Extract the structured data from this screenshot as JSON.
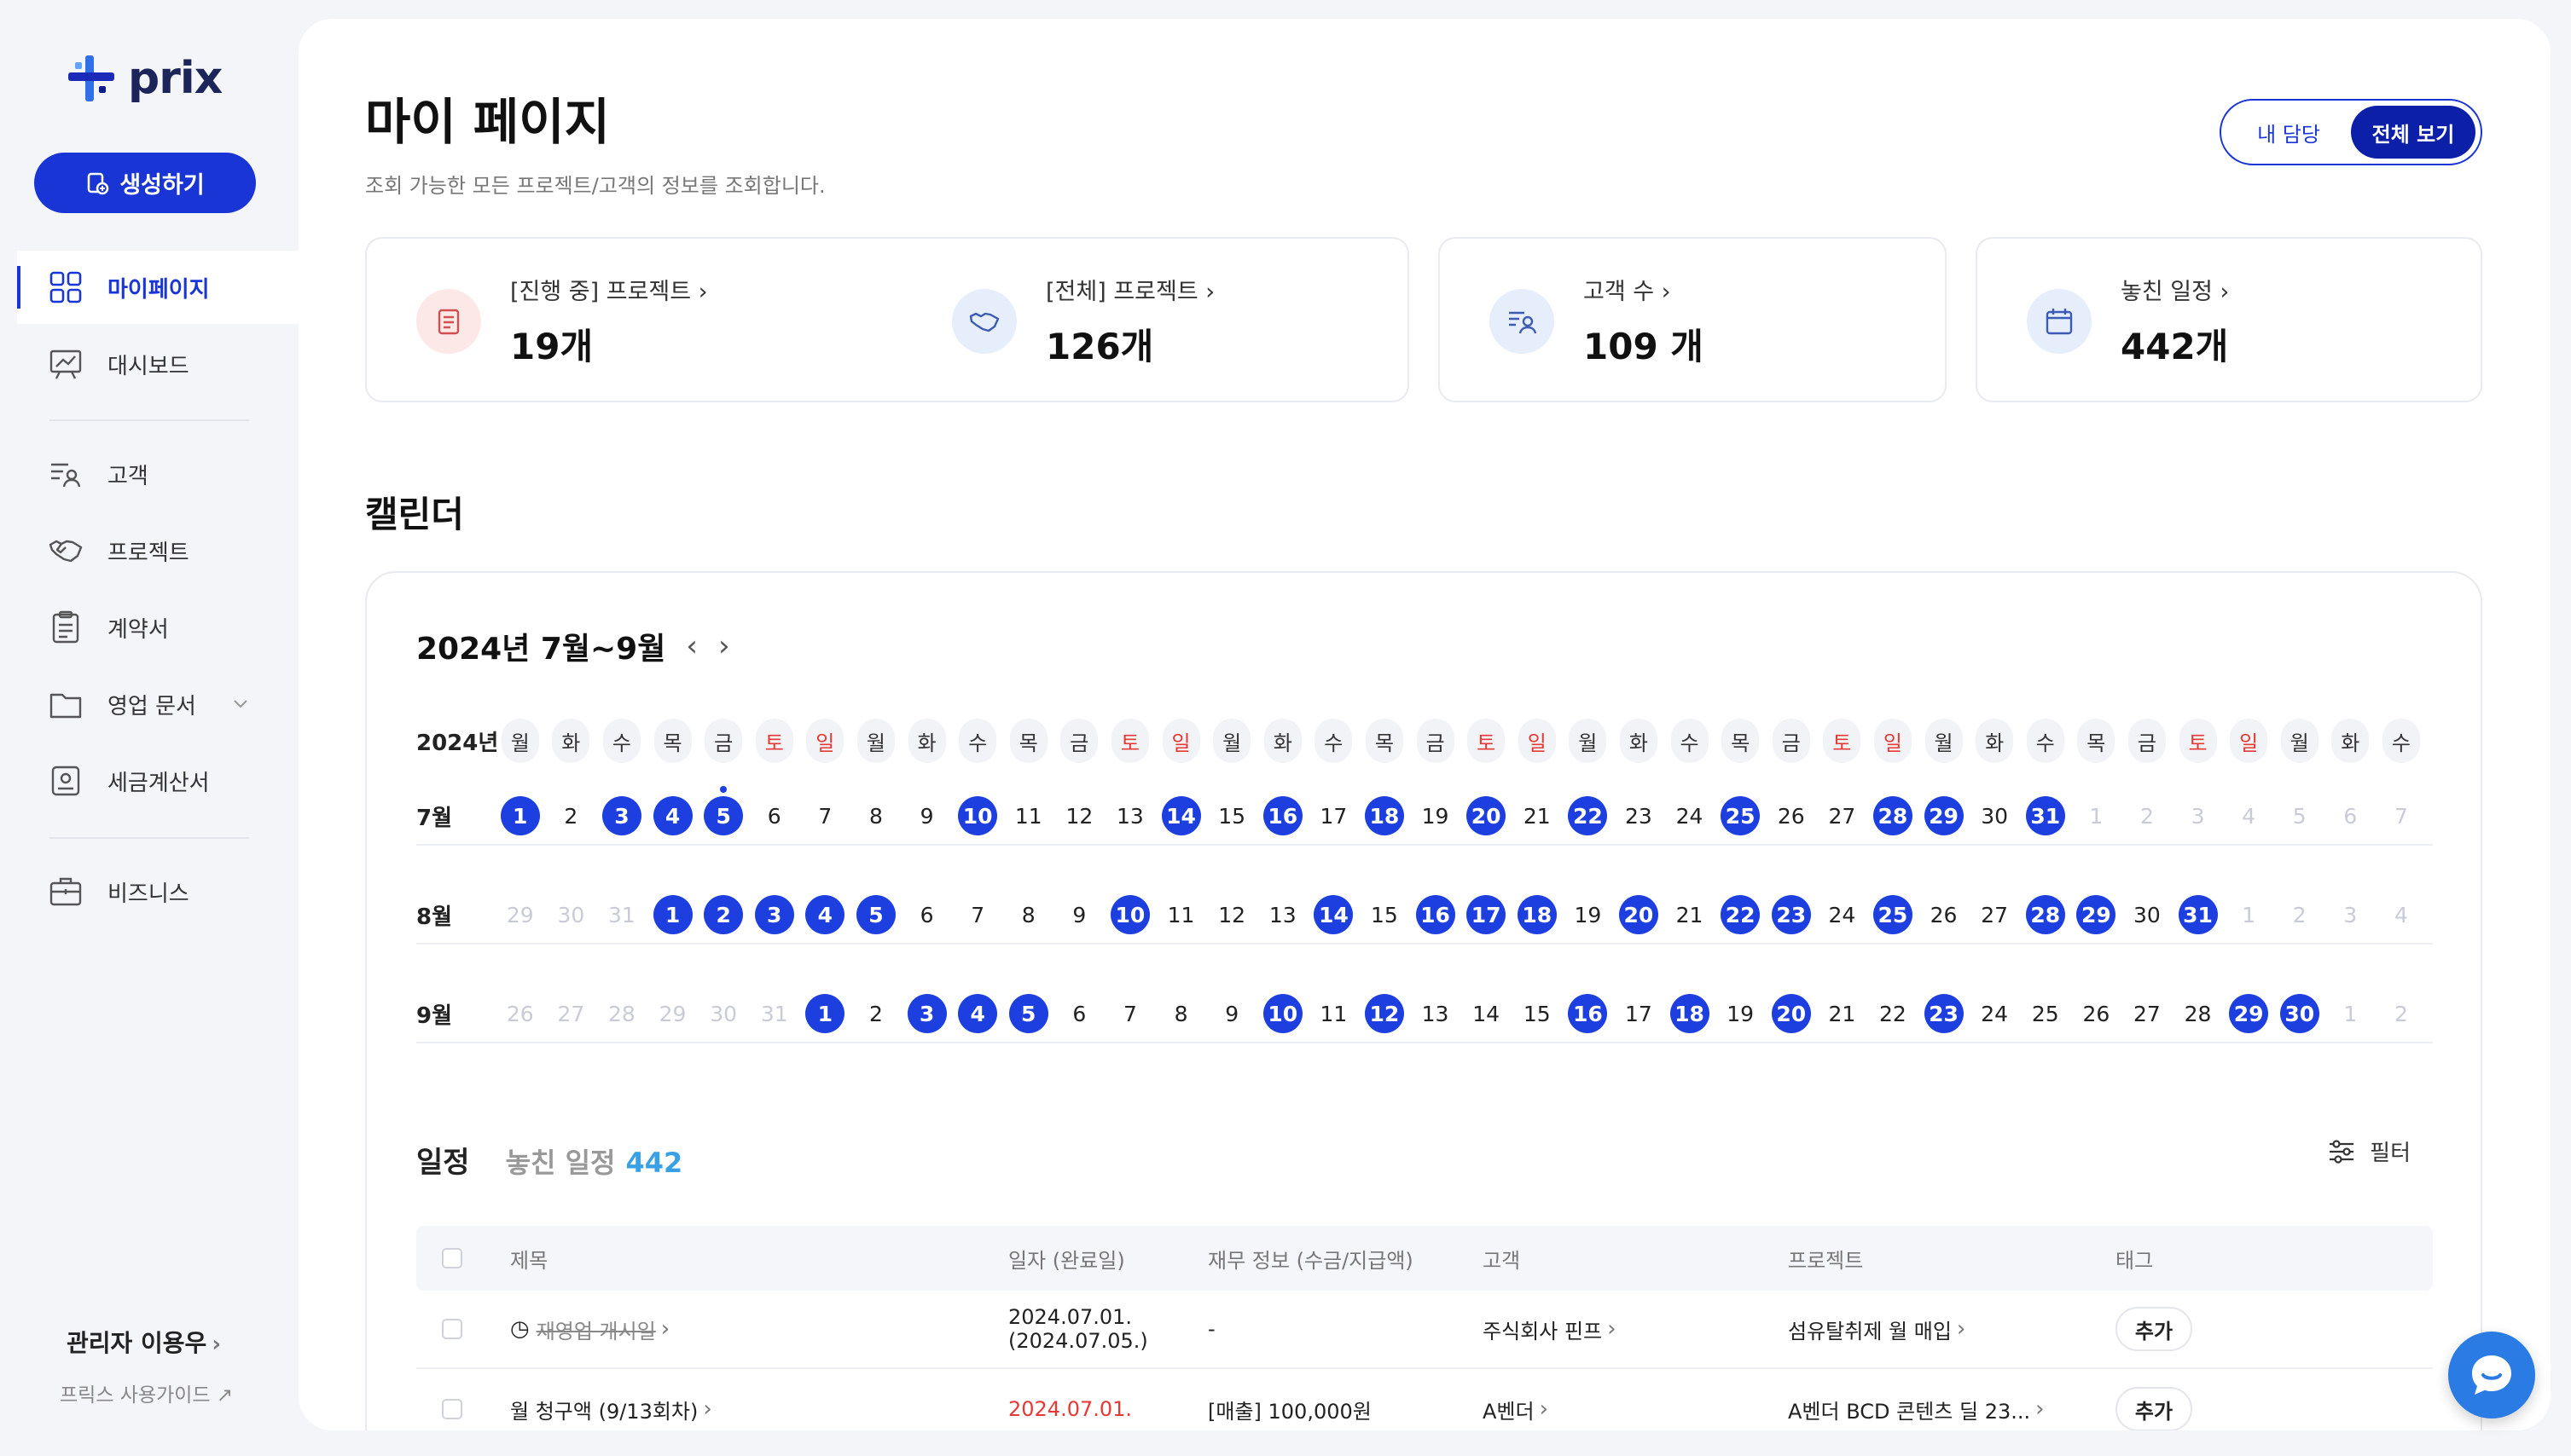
{
  "app": {
    "logo_text": "prix",
    "create_button": "생성하기"
  },
  "sidebar": {
    "items": [
      {
        "label": "마이페이지",
        "icon": "grid-icon"
      },
      {
        "label": "대시보드",
        "icon": "presentation-icon"
      },
      {
        "label": "고객",
        "icon": "customer-list-icon"
      },
      {
        "label": "프로젝트",
        "icon": "handshake-icon"
      },
      {
        "label": "계약서",
        "icon": "clipboard-icon"
      },
      {
        "label": "영업 문서",
        "icon": "folder-icon"
      },
      {
        "label": "세금계산서",
        "icon": "receipt-icon"
      },
      {
        "label": "비즈니스",
        "icon": "briefcase-icon"
      }
    ],
    "admin_name": "관리자 이용우",
    "guide_link": "프릭스 사용가이드"
  },
  "header": {
    "title": "마이 페이지",
    "subtitle": "조회 가능한 모든 프로젝트/고객의 정보를 조회합니다.",
    "toggle": {
      "mine": "내 담당",
      "all": "전체 보기",
      "selected": "all"
    }
  },
  "stats": [
    {
      "label": "[진행 중] 프로젝트",
      "value": "19개"
    },
    {
      "label": "[전체] 프로젝트",
      "value": "126개"
    },
    {
      "label": "고객 수",
      "value": "109 개"
    },
    {
      "label": "놓친 일정",
      "value": "442개"
    }
  ],
  "calendar": {
    "section_title": "캘린더",
    "range_title": "2024년 7월~9월",
    "year_label": "2024년",
    "weekdays": [
      "월",
      "화",
      "수",
      "목",
      "금",
      "토",
      "일",
      "월",
      "화",
      "수",
      "목",
      "금",
      "토",
      "일",
      "월",
      "화",
      "수",
      "목",
      "금",
      "토",
      "일",
      "월",
      "화",
      "수",
      "목",
      "금",
      "토",
      "일",
      "월",
      "화",
      "수",
      "목",
      "금",
      "토",
      "일",
      "월",
      "화",
      "수"
    ],
    "months": [
      {
        "label": "7월",
        "days": [
          "1",
          "2",
          "3",
          "4",
          "5",
          "6",
          "7",
          "8",
          "9",
          "10",
          "11",
          "12",
          "13",
          "14",
          "15",
          "16",
          "17",
          "18",
          "19",
          "20",
          "21",
          "22",
          "23",
          "24",
          "25",
          "26",
          "27",
          "28",
          "29",
          "30",
          "31",
          "1",
          "2",
          "3",
          "4",
          "5",
          "6",
          "7"
        ],
        "events": [
          1,
          3,
          4,
          5,
          10,
          14,
          16,
          18,
          20,
          22,
          25,
          28,
          29,
          31
        ],
        "dim_prefix": 0
      },
      {
        "label": "8월",
        "days": [
          "29",
          "30",
          "31",
          "1",
          "2",
          "3",
          "4",
          "5",
          "6",
          "7",
          "8",
          "9",
          "10",
          "11",
          "12",
          "13",
          "14",
          "15",
          "16",
          "17",
          "18",
          "19",
          "20",
          "21",
          "22",
          "23",
          "24",
          "25",
          "26",
          "27",
          "28",
          "29",
          "30",
          "31",
          "1",
          "2",
          "3",
          "4"
        ],
        "events": [
          1,
          2,
          3,
          4,
          5,
          10,
          14,
          16,
          17,
          18,
          20,
          22,
          23,
          25,
          28,
          29,
          31
        ],
        "dim_prefix": 3
      },
      {
        "label": "9월",
        "days": [
          "26",
          "27",
          "28",
          "29",
          "30",
          "31",
          "1",
          "2",
          "3",
          "4",
          "5",
          "6",
          "7",
          "8",
          "9",
          "10",
          "11",
          "12",
          "13",
          "14",
          "15",
          "16",
          "17",
          "18",
          "19",
          "20",
          "21",
          "22",
          "23",
          "24",
          "25",
          "26",
          "27",
          "28",
          "29",
          "30",
          "1",
          "2"
        ],
        "events": [
          1,
          3,
          4,
          5,
          10,
          12,
          16,
          18,
          20,
          23,
          29,
          30
        ],
        "dim_prefix": 6
      }
    ]
  },
  "schedule": {
    "title": "일정",
    "missed_label": "놓친 일정",
    "missed_count": "442",
    "filter_label": "필터",
    "columns": [
      "제목",
      "일자 (완료일)",
      "재무 정보 (수금/지급액)",
      "고객",
      "프로젝트",
      "태그"
    ],
    "rows": [
      {
        "title": "재영업 개시일",
        "date": "2024.07.01.",
        "date2": "(2024.07.05.)",
        "finance": "-",
        "customer": "주식회사 핀프",
        "project": "섬유탈취제 월 매입",
        "tag": "추가"
      },
      {
        "title": "월 청구액 (9/13회차)",
        "date": "2024.07.01.",
        "date2": "",
        "finance": "[매출] 100,000원",
        "customer": "A벤더",
        "project": "A벤더 BCD 콘텐츠 딜 23...",
        "tag": "추가"
      }
    ]
  }
}
